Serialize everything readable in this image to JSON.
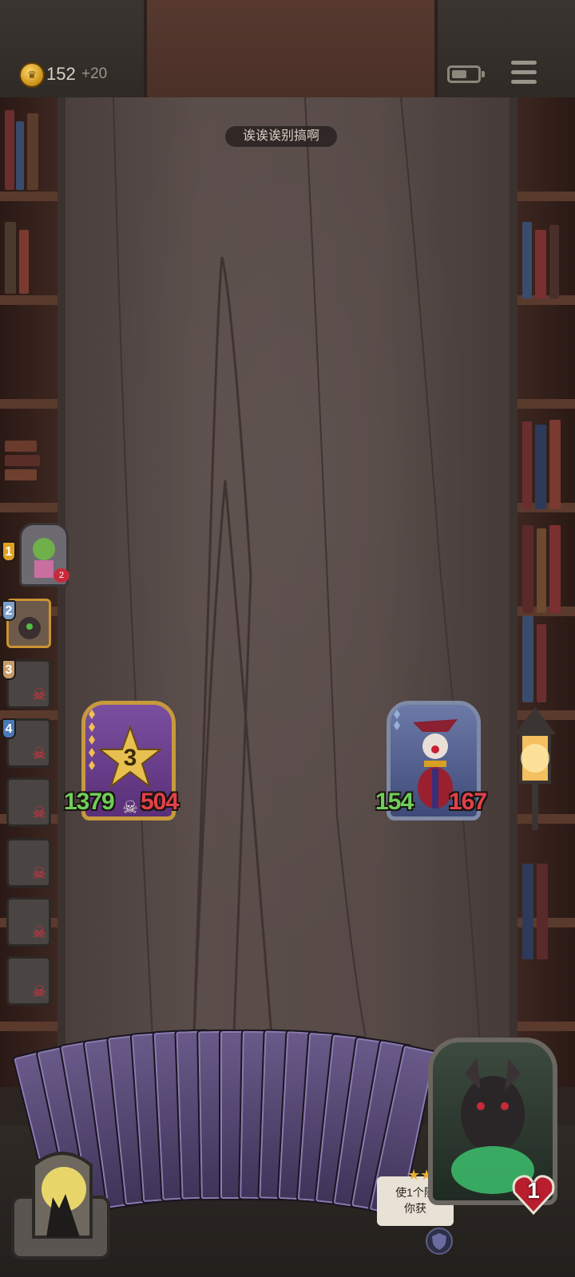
{
  "top_bar": {
    "coins": "152",
    "coin_bonus": "+20",
    "coin_symbol": "♛"
  },
  "board": {
    "name": "诶诶诶别搞啊"
  },
  "player_queue": [
    {
      "rank": "1",
      "status": "active",
      "badge": "2"
    },
    {
      "rank": "2",
      "status": "current"
    },
    {
      "rank": "3",
      "status": "dead"
    },
    {
      "rank": "4",
      "status": "dead"
    },
    {
      "rank": "",
      "status": "dead"
    },
    {
      "rank": "",
      "status": "dead"
    },
    {
      "rank": "",
      "status": "dead"
    },
    {
      "rank": "",
      "status": "dead"
    }
  ],
  "player_unit": {
    "level": "3",
    "attack": "1379",
    "health": "504",
    "frame_color": "#c79a3c"
  },
  "enemy_unit": {
    "attack": "154",
    "health": "167",
    "frame_color": "#7f8aa6"
  },
  "tooltip": {
    "line1": "使1个随",
    "line2": "你获"
  },
  "hero": {
    "level": "1"
  },
  "colors": {
    "attack": "#6fce5a",
    "health": "#e4404a",
    "gold": "#c9932f"
  }
}
